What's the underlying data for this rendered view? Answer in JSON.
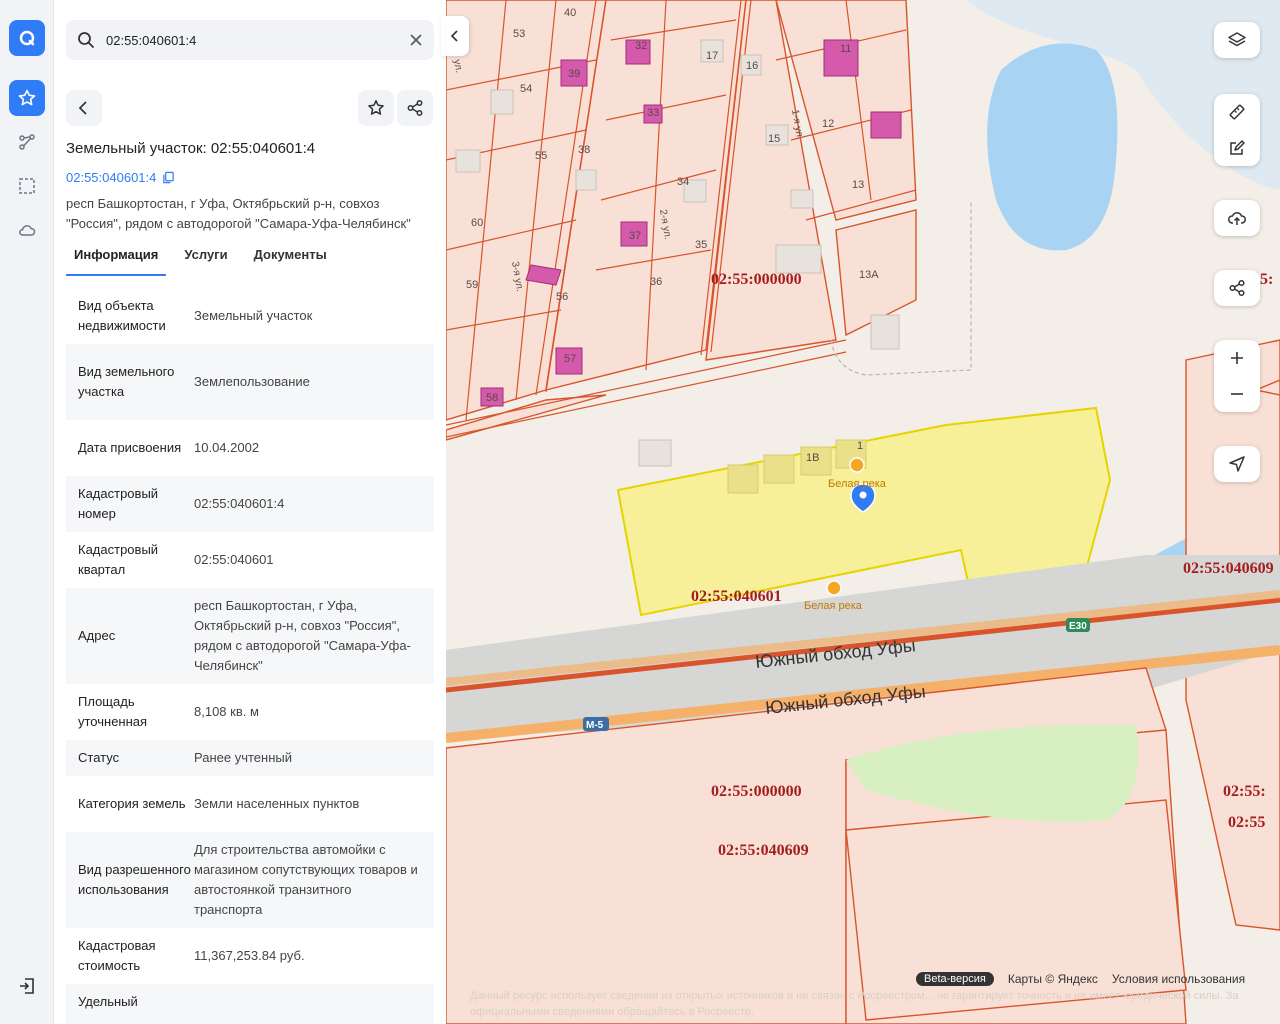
{
  "search": {
    "value": "02:55:040601:4"
  },
  "object": {
    "title": "Земельный участок: 02:55:040601:4",
    "cad_number": "02:55:040601:4",
    "address": "респ Башкортостан, г Уфа, Октябрьский р-н, совхоз \"Россия\", рядом с автодорогой \"Самара-Уфа-Челябинск\""
  },
  "tabs": [
    "Информация",
    "Услуги",
    "Документы"
  ],
  "properties": [
    {
      "key": "Вид объекта недвижимости",
      "value": "Земельный участок"
    },
    {
      "key": "Вид земельного участка",
      "value": "Землепользование"
    },
    {
      "key": "Дата присвоения",
      "value": "10.04.2002"
    },
    {
      "key": "Кадастровый номер",
      "value": "02:55:040601:4"
    },
    {
      "key": "Кадастровый квартал",
      "value": "02:55:040601"
    },
    {
      "key": "Адрес",
      "value": "респ Башкортостан, г Уфа, Октябрьский р-н, совхоз \"Россия\", рядом с автодорогой \"Самара-Уфа-Челябинск\""
    },
    {
      "key": "Площадь уточненная",
      "value": "8,108 кв. м"
    },
    {
      "key": "Статус",
      "value": "Ранее учтенный"
    },
    {
      "key": "Категория земель",
      "value": "Земли населенных пунктов"
    },
    {
      "key": "Вид разрешенного использования",
      "value": "Для строительства автомойки с магазином сопутствующих товаров и автостоянкой транзитного транспорта"
    },
    {
      "key": "Кадастровая стоимость",
      "value": "11,367,253.84 руб."
    },
    {
      "key": "Удельный",
      "value": ""
    }
  ],
  "map": {
    "quarter_labels": [
      "02:55:000000",
      "02:55:040601",
      "02:55:000000",
      "02:55:040609",
      "02:55:040609",
      "02:55:",
      "02:55",
      "5:"
    ],
    "road_labels": [
      "Южный обход Уфы",
      "Южный обход Уфы"
    ],
    "poi": [
      "Белая река",
      "Белая река"
    ],
    "route_badges": [
      "E30",
      "M-5"
    ],
    "plot_numbers": [
      "40",
      "53",
      "39",
      "54",
      "55",
      "38",
      "60",
      "59",
      "56",
      "57",
      "58",
      "37",
      "36",
      "35",
      "34",
      "33",
      "32",
      "17",
      "16",
      "15",
      "11",
      "12",
      "13",
      "13А",
      "1В",
      "1"
    ],
    "street_labels": [
      "1-я ул.",
      "2-я ул.",
      "3-я ул.",
      "ул."
    ],
    "colors": {
      "parcel_fill": "#f9e0d6",
      "parcel_stroke": "#d9542b",
      "selected_fill": "#f7f08a",
      "selected_stroke": "#e6d400",
      "water": "#a9d3f2",
      "road": "#d6d6d4",
      "road_orange": "#f5b16a",
      "label_red": "#a31d1d",
      "building": "#d65aab"
    }
  },
  "footer": {
    "beta": "Beta-версия",
    "copyright": "Карты © Яндекс",
    "terms": "Условия использования",
    "disclaimer": "Данный ресурс использует сведения из открытых источников и не связан с Росреестром... не гарантирует точность и не имеет юридической силы. За официальными сведениями обращайтесь в Росреестр."
  }
}
